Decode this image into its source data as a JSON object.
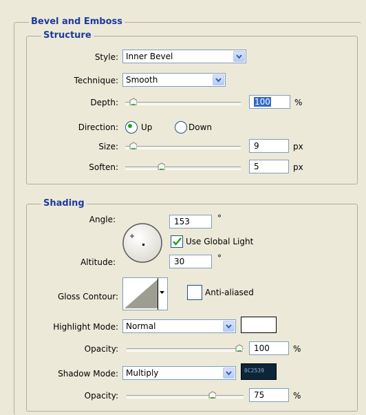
{
  "bevel": {
    "title": "Bevel and Emboss"
  },
  "structure": {
    "title": "Structure",
    "style": {
      "label": "Style:",
      "value": "Inner Bevel"
    },
    "technique": {
      "label": "Technique:",
      "value": "Smooth"
    },
    "depth": {
      "label": "Depth:",
      "value": "100",
      "unit": "%",
      "slider_fraction": 0.04
    },
    "direction": {
      "label": "Direction:",
      "up_label": "Up",
      "down_label": "Down",
      "selected": "Up"
    },
    "size": {
      "label": "Size:",
      "value": "9",
      "unit": "px",
      "slider_fraction": 0.04
    },
    "soften": {
      "label": "Soften:",
      "value": "5",
      "unit": "px",
      "slider_fraction": 0.3
    }
  },
  "shading": {
    "title": "Shading",
    "angle": {
      "label": "Angle:",
      "value": "153",
      "unit": "°"
    },
    "use_global_light": {
      "label": "Use Global Light",
      "checked": true
    },
    "altitude": {
      "label": "Altitude:",
      "value": "30",
      "unit": "°"
    },
    "gloss_contour": {
      "label": "Gloss Contour:"
    },
    "anti_aliased": {
      "label": "Anti-aliased",
      "checked": false
    },
    "highlight_mode": {
      "label": "Highlight Mode:",
      "value": "Normal",
      "color": "#ffffff"
    },
    "highlight_opacity": {
      "label": "Opacity:",
      "value": "100",
      "unit": "%",
      "slider_fraction": 1.0
    },
    "shadow_mode": {
      "label": "Shadow Mode:",
      "value": "Multiply",
      "color": "#0c2539",
      "color_label": "0C2539"
    },
    "shadow_opacity": {
      "label": "Opacity:",
      "value": "75",
      "unit": "%",
      "slider_fraction": 0.75
    }
  },
  "colors": {
    "accent": "#1c3a9e",
    "background": "#ece9d8",
    "selection": "#316ac5"
  }
}
